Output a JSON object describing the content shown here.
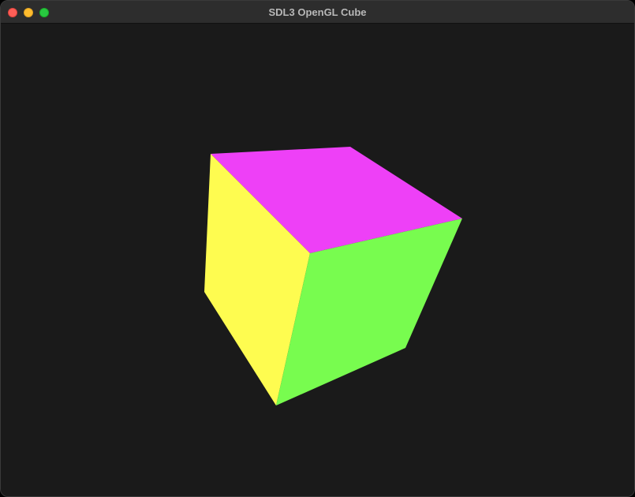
{
  "window": {
    "title": "SDL3 OpenGL Cube",
    "controls": [
      "close",
      "minimize",
      "zoom"
    ]
  },
  "scene": {
    "background_color": "#1a1a1a",
    "cube_faces": [
      {
        "name": "top",
        "color": "#ee40f7"
      },
      {
        "name": "left",
        "color": "#fefc50"
      },
      {
        "name": "front",
        "color": "#78fc4f"
      }
    ]
  },
  "colors": {
    "titlebar": "#2d2d2d",
    "close": "#fe5f57",
    "minimize": "#febc2e",
    "zoom": "#28c840"
  }
}
